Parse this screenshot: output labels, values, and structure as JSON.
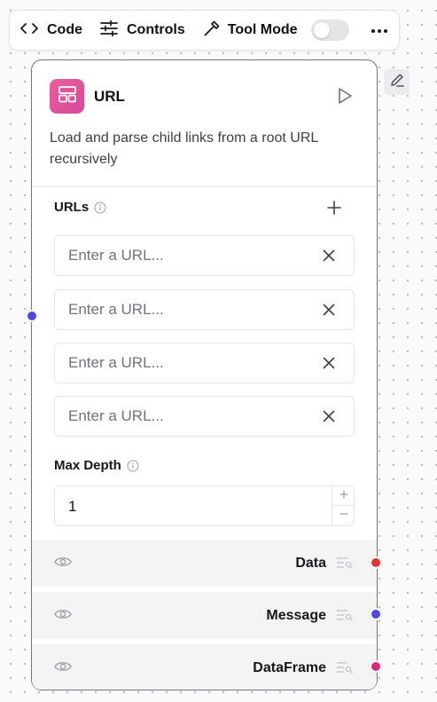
{
  "toolbar": {
    "code_label": "Code",
    "controls_label": "Controls",
    "tool_mode_label": "Tool Mode",
    "tool_mode_enabled": false
  },
  "node": {
    "title": "URL",
    "description": "Load and parse child links from a root URL recursively",
    "icon_gradient": [
      "#ee5b9b",
      "#d24d9a"
    ],
    "urls": {
      "label": "URLs",
      "inputs": [
        {
          "value": "",
          "placeholder": "Enter a URL..."
        },
        {
          "value": "",
          "placeholder": "Enter a URL..."
        },
        {
          "value": "",
          "placeholder": "Enter a URL..."
        },
        {
          "value": "",
          "placeholder": "Enter a URL..."
        }
      ]
    },
    "max_depth": {
      "label": "Max Depth",
      "value": "1"
    },
    "outputs": [
      {
        "name": "Data",
        "color": "#e5312f"
      },
      {
        "name": "Message",
        "color": "#4f46e5"
      },
      {
        "name": "DataFrame",
        "color": "#db2777"
      }
    ],
    "input_handle_color": "#4f46e5"
  }
}
